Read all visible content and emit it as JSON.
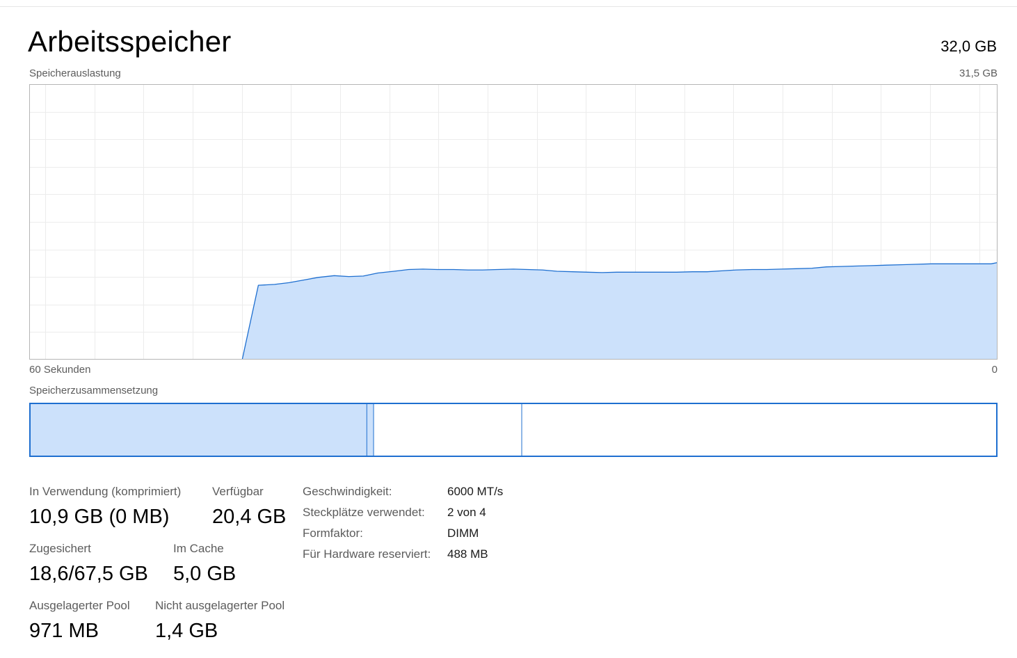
{
  "header": {
    "title": "Arbeitsspeicher",
    "total": "32,0 GB"
  },
  "usage_graph": {
    "label": "Speicherauslastung",
    "max_label": "31,5 GB",
    "time_left_label": "60 Sekunden",
    "time_right_label": "0",
    "accent_color": "#1e6fd0",
    "fill_color": "#cce1fb"
  },
  "chart_data": {
    "type": "area",
    "title": "Speicherauslastung",
    "xlabel": "",
    "ylabel": "",
    "xlim": [
      60,
      0
    ],
    "ylim": [
      0,
      31.5
    ],
    "grid": true,
    "x": [
      60,
      47,
      46.8,
      45.8,
      44.8,
      43.9,
      43.0,
      42.1,
      41.1,
      40.2,
      39.3,
      38.4,
      37.4,
      36.5,
      35.6,
      34.7,
      33.7,
      32.8,
      31.9,
      31.0,
      30.0,
      29.1,
      28.2,
      27.3,
      26.3,
      25.4,
      24.5,
      23.6,
      22.6,
      21.7,
      20.8,
      19.9,
      18.9,
      18.0,
      17.1,
      16.2,
      15.2,
      14.3,
      13.4,
      12.5,
      11.5,
      10.6,
      9.7,
      8.8,
      7.8,
      6.9,
      6.0,
      5.1,
      4.1,
      3.2,
      2.3,
      1.4,
      0.4,
      0
    ],
    "values": [
      0,
      0,
      0,
      8.5,
      8.6,
      8.8,
      9.1,
      9.4,
      9.6,
      9.5,
      9.55,
      9.9,
      10.1,
      10.3,
      10.35,
      10.3,
      10.3,
      10.25,
      10.25,
      10.3,
      10.35,
      10.3,
      10.25,
      10.1,
      10.05,
      10.0,
      9.95,
      10.0,
      10.0,
      10.0,
      10.0,
      10.0,
      10.05,
      10.05,
      10.15,
      10.25,
      10.3,
      10.3,
      10.35,
      10.4,
      10.45,
      10.6,
      10.65,
      10.7,
      10.75,
      10.8,
      10.85,
      10.9,
      10.95,
      10.95,
      10.95,
      10.95,
      10.95,
      11.1
    ]
  },
  "composition_bar": {
    "label": "Speicherzusammensetzung",
    "segments": [
      {
        "name": "in-use",
        "fraction": 0.349
      },
      {
        "name": "modified",
        "fraction": 0.007
      },
      {
        "name": "standby",
        "fraction": 0.153
      },
      {
        "name": "free",
        "fraction": 0.491
      }
    ]
  },
  "stats": {
    "in_use": {
      "label": "In Verwendung (komprimiert)",
      "value": "10,9 GB (0 MB)"
    },
    "available": {
      "label": "Verfügbar",
      "value": "20,4 GB"
    },
    "committed": {
      "label": "Zugesichert",
      "value": "18,6/67,5 GB"
    },
    "cached": {
      "label": "Im Cache",
      "value": "5,0 GB"
    },
    "paged_pool": {
      "label": "Ausgelagerter Pool",
      "value": "971 MB"
    },
    "nonpaged_pool": {
      "label": "Nicht ausgelagerter Pool",
      "value": "1,4 GB"
    }
  },
  "info": {
    "speed": {
      "label": "Geschwindigkeit:",
      "value": "6000 MT/s"
    },
    "slots": {
      "label": "Steckplätze verwendet:",
      "value": "2 von 4"
    },
    "form_factor": {
      "label": "Formfaktor:",
      "value": "DIMM"
    },
    "hw_reserved": {
      "label": "Für Hardware reserviert:",
      "value": "488 MB"
    }
  }
}
